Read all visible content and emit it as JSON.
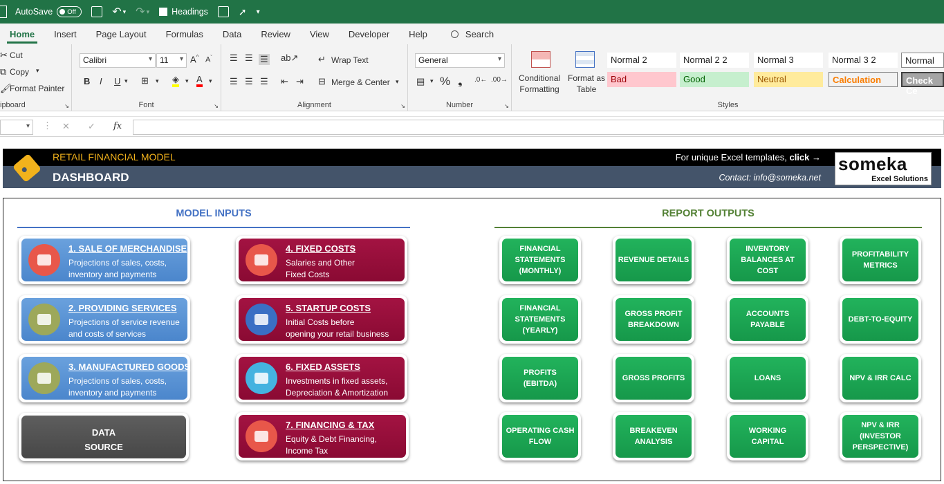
{
  "titlebar": {
    "autosave_label": "AutoSave",
    "autosave_state": "Off",
    "headings_label": "Headings"
  },
  "ribbon_tabs": [
    "Home",
    "Insert",
    "Page Layout",
    "Formulas",
    "Data",
    "Review",
    "View",
    "Developer",
    "Help"
  ],
  "search_label": "Search",
  "clipboard": {
    "cut": "Cut",
    "copy": "Copy",
    "format_painter": "Format Painter",
    "label": "ipboard"
  },
  "font": {
    "name": "Calibri",
    "size": "11",
    "label": "Font"
  },
  "alignment": {
    "wrap_text": "Wrap Text",
    "merge_center": "Merge & Center",
    "label": "Alignment"
  },
  "number": {
    "format": "General",
    "label": "Number"
  },
  "styles_group": {
    "conditional": "Conditional\nFormatting",
    "format_table": "Format as\nTable",
    "label": "Styles",
    "cells": [
      {
        "name": "Normal 2",
        "bg": "#ffffff",
        "fg": "#222222"
      },
      {
        "name": "Normal 2 2",
        "bg": "#ffffff",
        "fg": "#222222"
      },
      {
        "name": "Normal 3",
        "bg": "#ffffff",
        "fg": "#222222"
      },
      {
        "name": "Normal 3 2",
        "bg": "#ffffff",
        "fg": "#222222"
      },
      {
        "name": "Normal",
        "bg": "#ffffff",
        "fg": "#222222"
      },
      {
        "name": "Bad",
        "bg": "#ffc7ce",
        "fg": "#9c0006"
      },
      {
        "name": "Good",
        "bg": "#c6efce",
        "fg": "#006100"
      },
      {
        "name": "Neutral",
        "bg": "#ffeb9c",
        "fg": "#9c5700"
      },
      {
        "name": "Calculation",
        "bg": "#f2f2f2",
        "fg": "#fa7d00"
      },
      {
        "name": "Check Ce",
        "bg": "#a5a5a5",
        "fg": "#ffffff"
      }
    ]
  },
  "formula_bar": {
    "fx": "fx"
  },
  "banner": {
    "title": "RETAIL FINANCIAL MODEL",
    "subtitle": "DASHBOARD",
    "promo_text": "For unique Excel templates, ",
    "promo_link": "click →",
    "contact": "Contact: info@someka.net",
    "logo_word": "someka",
    "logo_sub": "Excel Solutions"
  },
  "sections": {
    "inputs_title": "MODEL INPUTS",
    "outputs_title": "REPORT OUTPUTS"
  },
  "inputs": [
    {
      "title": "1. SALE OF MERCHANDISE",
      "desc": "Projections of sales, costs,\ninventory and payments",
      "color": "blue",
      "icon": "store-icon",
      "circle": "#e8574a"
    },
    {
      "title": "2. PROVIDING SERVICES",
      "desc": "Projections of service revenue\nand costs of services",
      "color": "blue",
      "icon": "price-tag-icon",
      "circle": "#9da85a"
    },
    {
      "title": "3. MANUFACTURED GOODS",
      "desc": "Projections of sales, costs,\ninventory and payments",
      "color": "blue",
      "icon": "delivery-truck-icon",
      "circle": "#9da85a"
    },
    {
      "title": "4. FIXED COSTS",
      "desc": "Salaries and Other\nFixed Costs",
      "color": "red",
      "icon": "cash-register-icon",
      "circle": "#e8574a"
    },
    {
      "title": "5. STARTUP COSTS",
      "desc": "Initial Costs before\nopening your retail business",
      "color": "red",
      "icon": "rocket-icon",
      "circle": "#3a6fc4"
    },
    {
      "title": "6. FIXED ASSETS",
      "desc": "Investments in fixed assets,\nDepreciation & Amortization",
      "color": "red",
      "icon": "forklift-icon",
      "circle": "#45b3e0"
    },
    {
      "title": "7. FINANCING & TAX",
      "desc": "Equity & Debt Financing,\nIncome Tax",
      "color": "red",
      "icon": "money-bills-icon",
      "circle": "#e8574a"
    }
  ],
  "data_source": "DATA\nSOURCE",
  "outputs": [
    "FINANCIAL\nSTATEMENTS\n(MONTHLY)",
    "REVENUE DETAILS",
    "INVENTORY\nBALANCES AT\nCOST",
    "PROFITABILITY\nMETRICS",
    "FINANCIAL\nSTATEMENTS\n(YEARLY)",
    "GROSS PROFIT\nBREAKDOWN",
    "ACCOUNTS\nPAYABLE",
    "DEBT-TO-EQUITY",
    "PROFITS\n(EBITDA)",
    "GROSS PROFITS",
    "LOANS",
    "NPV & IRR CALC",
    "OPERATING CASH\nFLOW",
    "BREAKEVEN\nANALYSIS",
    "WORKING CAPITAL",
    "NPV & IRR\n(INVESTOR\nPERSPECTIVE)"
  ]
}
